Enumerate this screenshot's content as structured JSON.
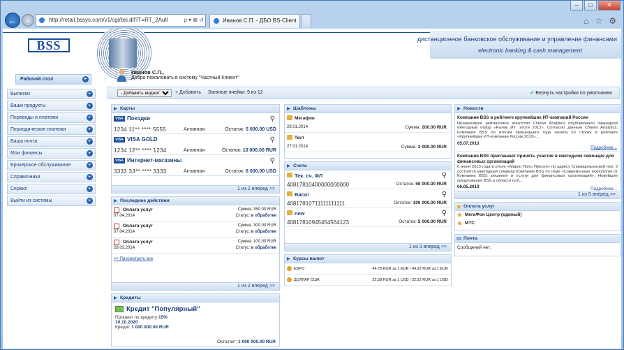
{
  "browser": {
    "url": "http://retail.bssys.com/v1/cgi/bsi.dll?T=RT_2Autl",
    "search_glyph": "ρ ▾ ⊠ ↺",
    "tab_title": "Иванов С.П. - ДБО BS-Client",
    "tool_glyphs": [
      "⌂",
      "☆",
      "⚙"
    ],
    "window_buttons": [
      "–",
      "□",
      "✕"
    ],
    "back_glyph": "←",
    "forward_glyph": "→"
  },
  "header": {
    "logo": "BSS",
    "tagline_ru": "дистанционное банковское обслуживание и управление финансами",
    "tagline_en": "electronic banking & cash management"
  },
  "sidebar": {
    "home": "Рабочий стол",
    "items": [
      {
        "label": "Выписки"
      },
      {
        "label": "Ваши продукты"
      },
      {
        "label": "Переводы и платежи"
      },
      {
        "label": "Периодические платежи"
      },
      {
        "label": "Ваша почта"
      },
      {
        "label": "Мои финансы"
      },
      {
        "label": "Брокерское обслуживание"
      },
      {
        "label": "Справочники"
      },
      {
        "label": "Сервис"
      },
      {
        "label": "Выйти из системы"
      }
    ]
  },
  "user": {
    "name": "Иванов С.П.,",
    "welcome": "Добро пожаловать в систему \"Частный Клиент\""
  },
  "toolbar": {
    "widget_select": "- Добавить виджет -",
    "add_label": "+ Добавить",
    "occupied": "Занятые ячейки: 9 из 12",
    "reset": "Вернуть настройки по умолчанию"
  },
  "cards": {
    "title": "Карты",
    "items": [
      {
        "name": "Поездки",
        "number": "1234 11** **** 5555",
        "status": "Активная",
        "balance_label": "Остаток:",
        "balance": "5 000.00 USD"
      },
      {
        "name": "VISA GOLD",
        "number": "1234 12** **** 1234",
        "status": "Активная",
        "balance_label": "Остаток:",
        "balance": "10 000.00 RUR"
      },
      {
        "name": "Интернет-магазины",
        "number": "3333 33** **** 3333",
        "status": "Активная",
        "balance_label": "Остаток:",
        "balance": "6 000.00 USD"
      }
    ],
    "pager": "1 из 2 вперед >>"
  },
  "actions": {
    "title": "Последние действия",
    "items": [
      {
        "name": "Оплата услуг",
        "sum": "Сумма: 350.00 RUR",
        "date": "07.04.2014",
        "status_label": "Статус:",
        "status": "в обработке"
      },
      {
        "name": "Оплата услуг",
        "sum": "Сумма: 300.00 RUR",
        "date": "07.04.2014",
        "status_label": "Статус:",
        "status": "в обработке"
      },
      {
        "name": "Оплата услуг",
        "sum": "Сумма: 100.00 RUR",
        "date": "28.03.2014",
        "status_label": "Статус:",
        "status": "в обработке"
      }
    ],
    "more_link": ">> Просмотреть все",
    "pager": "1 из 2 вперед >>"
  },
  "credits": {
    "title": "Кредиты",
    "name": "Кредит \"Популярный\"",
    "rate_label": "Процент по кредиту:",
    "rate": "15%",
    "date": "10.10.2020",
    "sum_label": "Кредит",
    "sum": "1 000 000.00 RUR",
    "rest_label": "Остаток*:",
    "rest": "1 000 000.00 RUR"
  },
  "templates": {
    "title": "Шаблоны",
    "items": [
      {
        "name": "Мегафон",
        "date": "28.01.2014",
        "sum_label": "Сумма:",
        "sum": "200.00 RUR"
      },
      {
        "name": "Тест",
        "date": "27.01.2014",
        "sum_label": "Сумма:",
        "sum": "3 000.00 RUR"
      }
    ]
  },
  "accounts": {
    "title": "Счета",
    "items": [
      {
        "name": "Тек. сч. ФЛ",
        "number": "40817810400000000000",
        "balance_label": "Остаток:",
        "balance": "50 000.00 RUR"
      },
      {
        "name": "Вася!",
        "number": "40817810711111111111",
        "balance_label": "Остаток:",
        "balance": "100 000.00 RUR"
      },
      {
        "name": "new",
        "number": "40817810945454564123",
        "balance_label": "Остаток:",
        "balance": "5 000.00 RUR"
      }
    ],
    "pager": "1 из 3 вперед >>"
  },
  "rates": {
    "title": "Курсы валют",
    "items": [
      {
        "name": "ЕВРО",
        "value": "44.78 RUR за 1 EUR  |  44.22 RUR за 1 EUR"
      },
      {
        "name": "ДОЛЛАР США",
        "value": "32.58 RUR за 1 USD  |  32.22 RUR за 1 USD"
      }
    ]
  },
  "news": {
    "title": "Новости",
    "items": [
      {
        "headline": "Компания BSS в рейтинге крупнейших ИТ-компаний России",
        "body": "Независимое рейтинговое агентство CNews Analytics опубликовало очередной ежегодный обзор «Рынок ИТ: итоги 2012». Согласно данным CNews Analytics, Компания BSS по итогам прошедшего года заняла 63 строку в рейтинге «Крупнейшие ИТ-компании России 2012»...",
        "date": "05.07.2013",
        "more": "Подробнее..."
      },
      {
        "headline": "Компания BSS приглашает принять участие в ежегодном семинаре для финансовых организаций",
        "body": "6 июня 2013 года в отеле «Марко Поло Пресня» по адресу Спиридоньевский пер. 9 состоится ежегодный семинар Компании BSS по теме «Современные технологии от Компании BSS: решения и услуги для финансовых организаций». Новейшие предложения BSS в области ноб...",
        "date": "06.05.2013",
        "more": "Подробнее..."
      }
    ],
    "pager": "1 из 5 вперед >>"
  },
  "services": {
    "title": "Оплата услуг",
    "items": [
      {
        "name": "МегаФон Центр (единый)"
      },
      {
        "name": "МТС"
      }
    ]
  },
  "mail": {
    "title": "Почта",
    "empty": "Сообщений нет."
  }
}
